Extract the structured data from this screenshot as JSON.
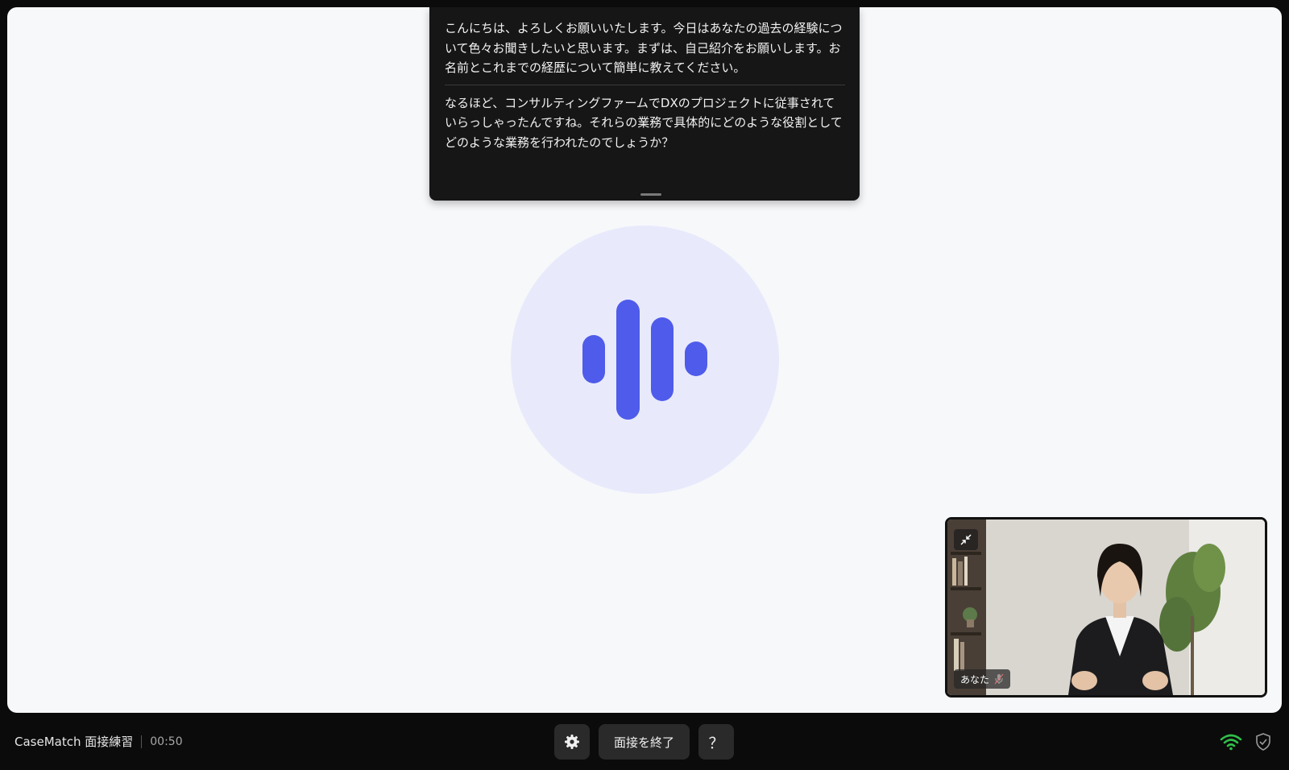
{
  "transcript": {
    "messages": [
      "こんにちは、よろしくお願いいたします。今日はあなたの過去の経験について色々お聞きしたいと思います。まずは、自己紹介をお願いします。お名前とこれまでの経歴について簡単に教えてください。",
      "なるほど、コンサルティングファームでDXのプロジェクトに従事されていらっしゃったんですね。それらの業務で具体的にどのような役割としてどのような業務を行われたのでしょうか？"
    ]
  },
  "voice_indicator": {
    "icon": "audio-wave-icon",
    "color": "#4f5bea",
    "background": "#e8eafc"
  },
  "self_view": {
    "name_label": "あなた",
    "mic_icon": "mic-muted-icon",
    "minimize_icon": "minimize-icon"
  },
  "footer": {
    "app_name": "CaseMatch 面接練習",
    "timer": "00:50",
    "settings_icon": "gear-icon",
    "end_button_label": "面接を終了",
    "help_button_label": "？",
    "connection_icon": "wifi-icon",
    "connection_color": "#2fbf4a",
    "security_icon": "shield-check-icon"
  }
}
